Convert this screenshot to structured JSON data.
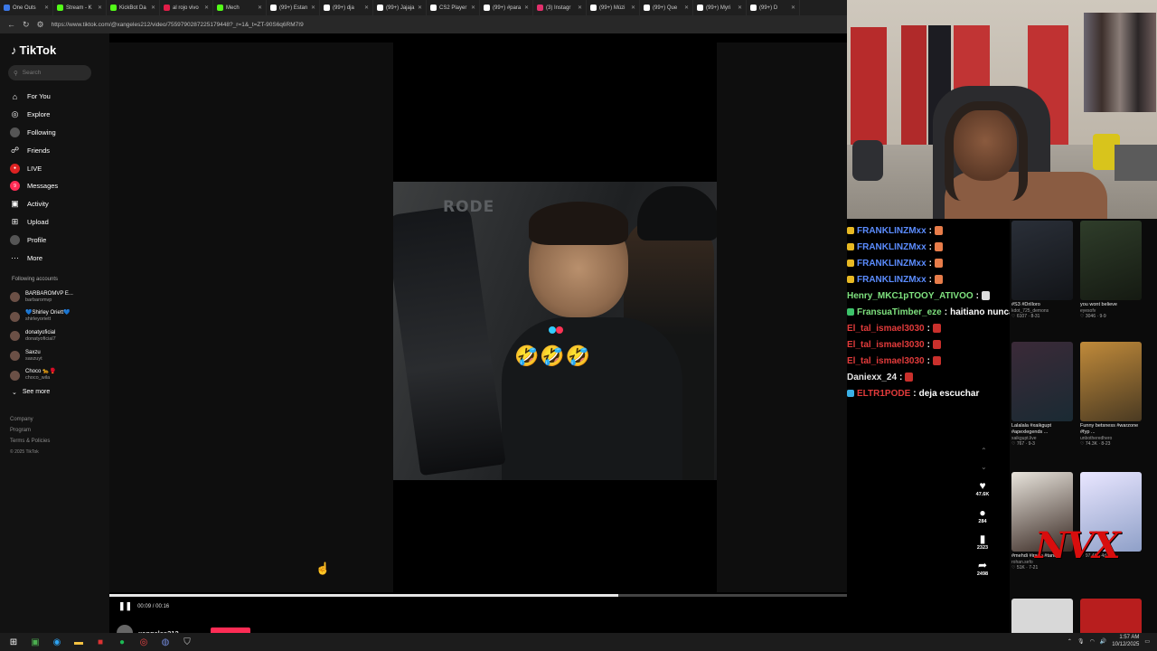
{
  "browser": {
    "tabs": [
      {
        "title": "One Outs",
        "color": "#3b78e7"
      },
      {
        "title": "Stream - K",
        "color": "#53fc18"
      },
      {
        "title": "KickBot Da",
        "color": "#53fc18"
      },
      {
        "title": "al rojo vivo",
        "color": "#e11d48"
      },
      {
        "title": "Mech",
        "color": "#53fc18"
      },
      {
        "title": "(99+) Estan",
        "color": "#ffffff"
      },
      {
        "title": "(99+) dja",
        "color": "#ffffff"
      },
      {
        "title": "(99+) Jajaja",
        "color": "#ffffff"
      },
      {
        "title": "CS2 Player",
        "color": "#ffffff"
      },
      {
        "title": "(99+) #para",
        "color": "#ffffff"
      },
      {
        "title": "(3) Instagr",
        "color": "#e1306c"
      },
      {
        "title": "(99+) Múzi",
        "color": "#ffffff"
      },
      {
        "title": "(99+) Que",
        "color": "#ffffff"
      },
      {
        "title": "(99+) Myri",
        "color": "#ffffff"
      },
      {
        "title": "(99+) D",
        "color": "#ffffff"
      }
    ],
    "url": "https://www.tiktok.com/@xangeles212/video/7559790287225179448?_r=1&_t=ZT-90S6q6RM7I9"
  },
  "sidebar": {
    "logo": "TikTok",
    "search_placeholder": "Search",
    "nav": [
      {
        "label": "For You",
        "icon": "home-icon",
        "glyph": "⌂"
      },
      {
        "label": "Explore",
        "icon": "compass-icon",
        "glyph": "◎"
      },
      {
        "label": "Following",
        "icon": "following-avatar-icon",
        "glyph": ""
      },
      {
        "label": "Friends",
        "icon": "friends-icon",
        "glyph": "☍"
      },
      {
        "label": "LIVE",
        "icon": "live-icon",
        "glyph": "●"
      },
      {
        "label": "Messages",
        "icon": "messages-icon",
        "glyph": "9"
      },
      {
        "label": "Activity",
        "icon": "activity-icon",
        "glyph": "▣"
      },
      {
        "label": "Upload",
        "icon": "upload-icon",
        "glyph": "⊞"
      },
      {
        "label": "Profile",
        "icon": "profile-avatar-icon",
        "glyph": ""
      },
      {
        "label": "More",
        "icon": "more-icon",
        "glyph": "···"
      }
    ],
    "following_title": "Following accounts",
    "following": [
      {
        "name": "BARBAROMVP E...",
        "user": "barbaromvp"
      },
      {
        "name": "💙Shirley Oriett💙",
        "user": "shirleyoriett"
      },
      {
        "name": "donatyoficial",
        "user": "donatyoficial7"
      },
      {
        "name": "Saxzu",
        "user": "saxzuyt"
      },
      {
        "name": "Choco 🐆🥊",
        "user": "choco_wila"
      }
    ],
    "see_more": "See more",
    "footer": [
      "Company",
      "Program",
      "Terms & Policies"
    ],
    "copyright": "© 2025 TikTok"
  },
  "video": {
    "watermark": "RODE",
    "emoji": "🤣🤣🤣",
    "time": "00:09 / 00:16",
    "progress": 0.69,
    "author": "xangeles212",
    "likes": "47.6K",
    "comments": "284",
    "saves": "2323",
    "shares": "2498"
  },
  "chat": [
    {
      "user": "FRANKLINZMxx",
      "sep": " :",
      "msg": "",
      "color": "#5b8cff",
      "badge": "#e8b923",
      "emo": "#e87d4a"
    },
    {
      "user": "FRANKLINZMxx",
      "sep": " :",
      "msg": "",
      "color": "#5b8cff",
      "badge": "#e8b923",
      "emo": "#e87d4a"
    },
    {
      "user": "FRANKLINZMxx",
      "sep": " :",
      "msg": "",
      "color": "#5b8cff",
      "badge": "#e8b923",
      "emo": "#e87d4a"
    },
    {
      "user": "FRANKLINZMxx",
      "sep": " :",
      "msg": "",
      "color": "#5b8cff",
      "badge": "#e8b923",
      "emo": "#e87d4a"
    },
    {
      "user": "Henry_MKC1pTOOY_ATIVOO",
      "sep": " :",
      "msg": "",
      "color": "#7fe27f",
      "badge": "",
      "emo": "#dddddd"
    },
    {
      "user": "FransuaTimber_eze",
      "sep": " :",
      "msg": " haitiano nunca hablar mal de haitiano",
      "color": "#7fe27f",
      "badge": "#3cc36a",
      "emo": ""
    },
    {
      "user": "El_tal_ismael3030",
      "sep": " :",
      "msg": "",
      "color": "#e23b3b",
      "badge": "",
      "emo": "#c9302c"
    },
    {
      "user": "El_tal_ismael3030",
      "sep": " :",
      "msg": "",
      "color": "#e23b3b",
      "badge": "",
      "emo": "#c9302c"
    },
    {
      "user": "El_tal_ismael3030",
      "sep": " :",
      "msg": "",
      "color": "#e23b3b",
      "badge": "",
      "emo": "#c9302c"
    },
    {
      "user": "Daniexx_24",
      "sep": " :",
      "msg": "",
      "color": "#e6e6e6",
      "badge": "",
      "emo": "#c9302c"
    },
    {
      "user": "ELTR1PODE",
      "sep": " :",
      "msg": " deja escuchar",
      "color": "#e23b3b",
      "badge": "#3ab0e6",
      "emo": ""
    }
  ],
  "suggested": [
    {
      "title": "#S3 #Drilloro",
      "user": "kdot_725_demons",
      "meta": "♡ 6107 · 8-31",
      "color1": "#2a2f38",
      "color2": "#121418"
    },
    {
      "title": "you wont believe",
      "user": "eyesofv",
      "meta": "♡ 3046 · 9-9",
      "color1": "#2f3d2a",
      "color2": "#151a12"
    },
    {
      "title": "Lalalala #xaikgupt #apexlegends ...",
      "user": "xaikgupt.live",
      "meta": "♡ 767 · 9-3",
      "color1": "#3b2a38",
      "color2": "#1a2a33"
    },
    {
      "title": "Funny betsness #warzone #fyp ...",
      "user": "unbotheredhero",
      "meta": "♡ 74.3K · 8-23",
      "color1": "#c08a3a",
      "color2": "#4a3a22"
    },
    {
      "title": "#mehdi #iraan #tanci",
      "user": "rohan.sefo",
      "meta": "♡ 51K · 7-21",
      "color1": "#e8e4dc",
      "color2": "#3a2a24"
    },
    {
      "title": "",
      "user": "",
      "meta": "♡ 97.4K · 4d ago",
      "color1": "#e9e6ff",
      "color2": "#8fa0c8"
    }
  ],
  "overlay_logo": "NVX",
  "taskbar": {
    "time": "1:57 AM",
    "date": "10/12/2025"
  }
}
